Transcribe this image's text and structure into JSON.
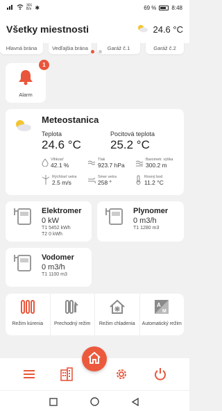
{
  "status": {
    "net_top": "301",
    "net_bottom": "B/s",
    "battery": "69 %",
    "time": "8:48"
  },
  "header": {
    "title": "Všetky miestnosti",
    "temperature": "24.6 °C"
  },
  "gates": [
    "Hlavná brána",
    "Vedľajšia brána",
    "Garáž č.1",
    "Garáž č.2"
  ],
  "alarm": {
    "label": "Alarm",
    "badge": "1"
  },
  "meteo": {
    "title": "Meteostanica",
    "temp_label": "Teplota",
    "temp_value": "24.6 °C",
    "feels_label": "Pocitová teplota",
    "feels_value": "25.2 °C",
    "humidity_label": "Vlhkosť",
    "humidity_value": "42.1 %",
    "pressure_label": "Tlak",
    "pressure_value": "923.7 hPa",
    "altitude_label": "Barometr. výška",
    "altitude_value": "300.2 m",
    "wind_speed_label": "Rýchlosť vetra",
    "wind_speed_value": "2.5 m/s",
    "wind_dir_label": "Smer vetra",
    "wind_dir_value": "258 °",
    "dew_label": "Rosný bod",
    "dew_value": "11.2 °C"
  },
  "meters": {
    "electric": {
      "name": "Elektromer",
      "value": "0 kW",
      "t1": "T1 5452 kWh",
      "t2": "T2 0 kWh"
    },
    "gas": {
      "name": "Plynomer",
      "value": "0 m3/h",
      "t1": "T1 1280 m3"
    },
    "water": {
      "name": "Vodomer",
      "value": "0 m3/h",
      "t1": "T1 1100 m3"
    }
  },
  "modes": [
    {
      "label": "Režim kúrenia",
      "icon": "radiator-icon"
    },
    {
      "label": "Prechodný režim",
      "icon": "transition-icon"
    },
    {
      "label": "Režim chladenia",
      "icon": "cooling-house-icon"
    },
    {
      "label": "Automatický režim",
      "icon": "auto-mode-icon"
    }
  ],
  "colors": {
    "accent": "#e8563b",
    "icon_gray": "#8a8a8a"
  }
}
